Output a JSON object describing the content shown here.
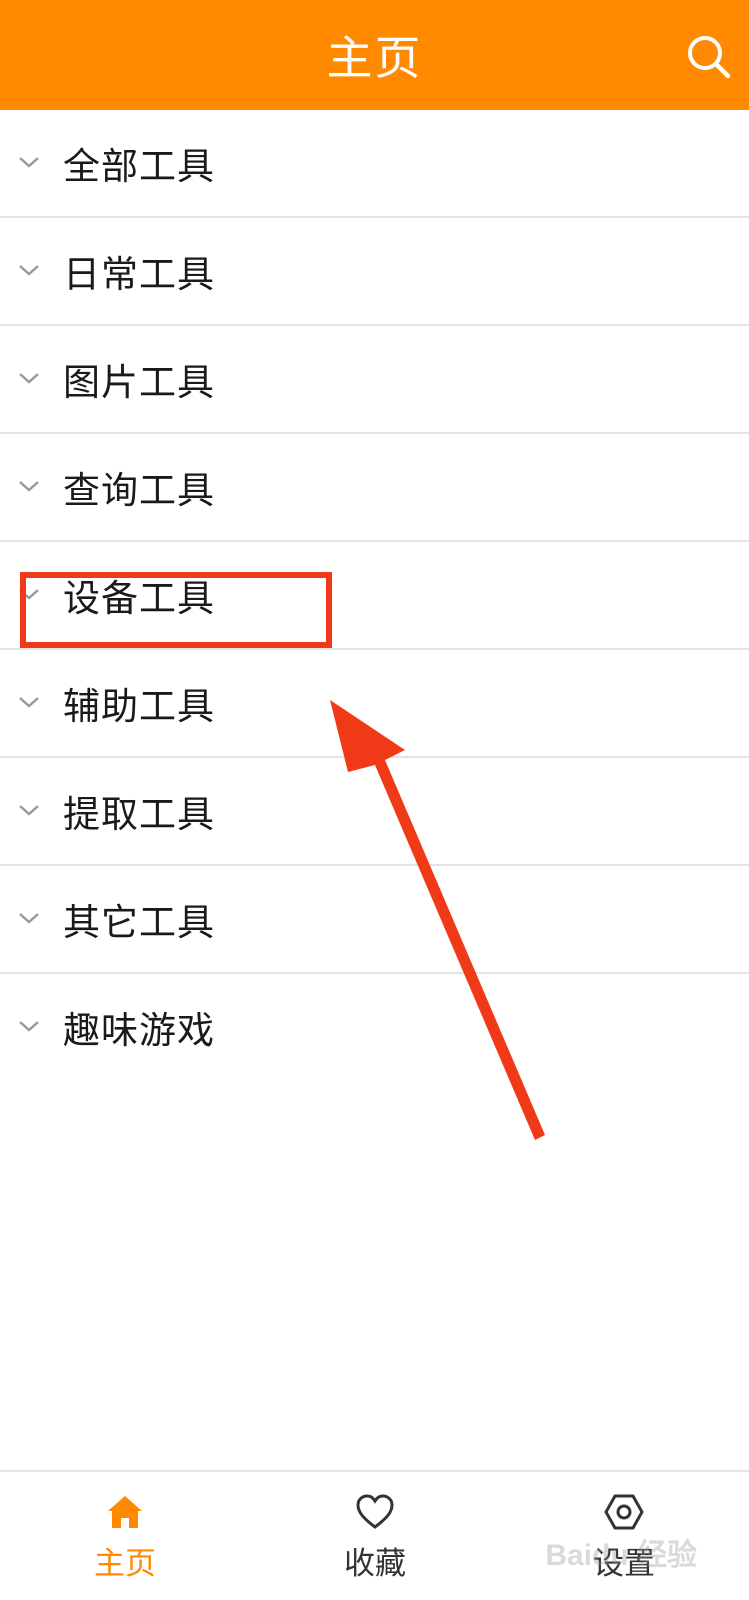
{
  "theme": {
    "brand_color": "#ff8a00",
    "annotation_color": "#f03a17"
  },
  "header": {
    "title": "主页",
    "search_icon": "search-icon"
  },
  "categories": [
    {
      "label": "全部工具",
      "icon": "chevron-down-icon"
    },
    {
      "label": "日常工具",
      "icon": "chevron-down-icon"
    },
    {
      "label": "图片工具",
      "icon": "chevron-down-icon"
    },
    {
      "label": "查询工具",
      "icon": "chevron-down-icon"
    },
    {
      "label": "设备工具",
      "icon": "chevron-down-icon"
    },
    {
      "label": "辅助工具",
      "icon": "chevron-down-icon"
    },
    {
      "label": "提取工具",
      "icon": "chevron-down-icon"
    },
    {
      "label": "其它工具",
      "icon": "chevron-down-icon"
    },
    {
      "label": "趣味游戏",
      "icon": "chevron-down-icon"
    }
  ],
  "annotation": {
    "highlighted_item": "设备工具"
  },
  "tabbar": {
    "tabs": [
      {
        "label": "主页",
        "icon": "home-icon",
        "active": true
      },
      {
        "label": "收藏",
        "icon": "heart-icon",
        "active": false
      },
      {
        "label": "设置",
        "icon": "settings-icon",
        "active": false
      }
    ]
  },
  "watermark": {
    "text": "Baidu 经验"
  }
}
